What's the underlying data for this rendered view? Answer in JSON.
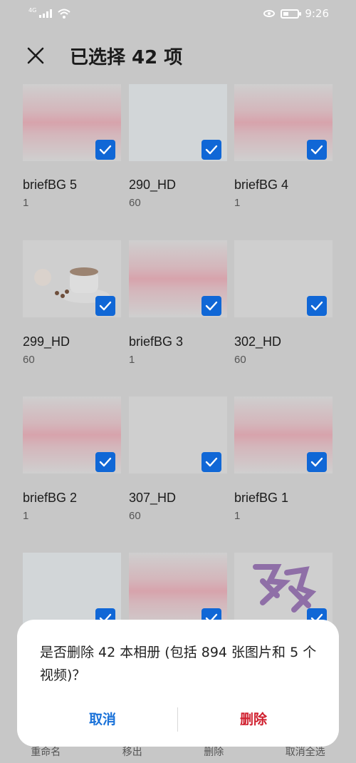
{
  "status_bar": {
    "network": "4G",
    "time": "9:26"
  },
  "header": {
    "title": "已选择 42 项"
  },
  "albums": [
    {
      "name": "briefBG 5",
      "count": "1",
      "thumb": "pink"
    },
    {
      "name": "290_HD",
      "count": "60",
      "thumb": "light"
    },
    {
      "name": "briefBG 4",
      "count": "1",
      "thumb": "pink"
    },
    {
      "name": "299_HD",
      "count": "60",
      "thumb": "plain"
    },
    {
      "name": "briefBG 3",
      "count": "1",
      "thumb": "pink"
    },
    {
      "name": "302_HD",
      "count": "60",
      "thumb": "plain"
    },
    {
      "name": "briefBG 2",
      "count": "1",
      "thumb": "pink"
    },
    {
      "name": "307_HD",
      "count": "60",
      "thumb": "plain"
    },
    {
      "name": "briefBG 1",
      "count": "1",
      "thumb": "pink"
    },
    {
      "name": "",
      "count": "",
      "thumb": "light"
    },
    {
      "name": "",
      "count": "",
      "thumb": "pink"
    },
    {
      "name": "",
      "count": "",
      "thumb": "plain"
    }
  ],
  "bottom_actions": [
    "重命名",
    "移出",
    "删除",
    "取消全选"
  ],
  "dialog": {
    "message": "是否删除 42 本相册 (包括 894 张图片和 5 个视频)？",
    "cancel_label": "取消",
    "delete_label": "删除"
  },
  "colors": {
    "accent": "#1067d6",
    "delete": "#d0202f",
    "cancel": "#1a72d9",
    "scrim": "#c7c7c7"
  }
}
